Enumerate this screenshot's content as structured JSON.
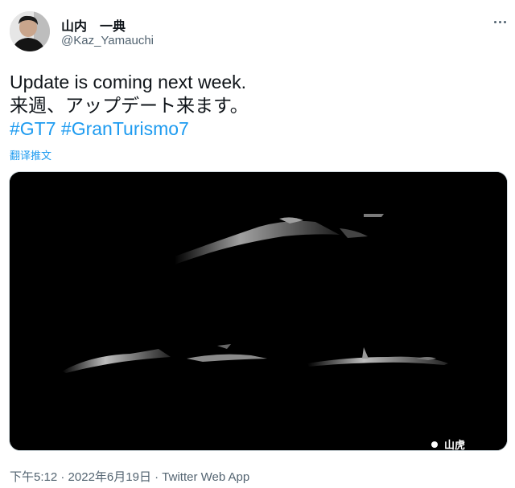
{
  "author": {
    "display_name": "山内　一典",
    "handle": "@Kaz_Yamauchi"
  },
  "tweet": {
    "line1": "Update is coming next week.",
    "line2": "来週、アップデート来ます。",
    "hashtags": [
      "#GT7",
      "#GranTurismo7"
    ],
    "translate_label": "翻译推文"
  },
  "media": {
    "watermark": "山虎"
  },
  "meta": {
    "time": "下午5:12",
    "separator": "·",
    "date": "2022年6月19日",
    "source": "Twitter Web App"
  },
  "icons": {
    "more": "more-horizontal-icon"
  },
  "colors": {
    "link": "#1d9bf0",
    "text": "#0f1419",
    "secondary": "#536471",
    "media_bg": "#000000"
  }
}
